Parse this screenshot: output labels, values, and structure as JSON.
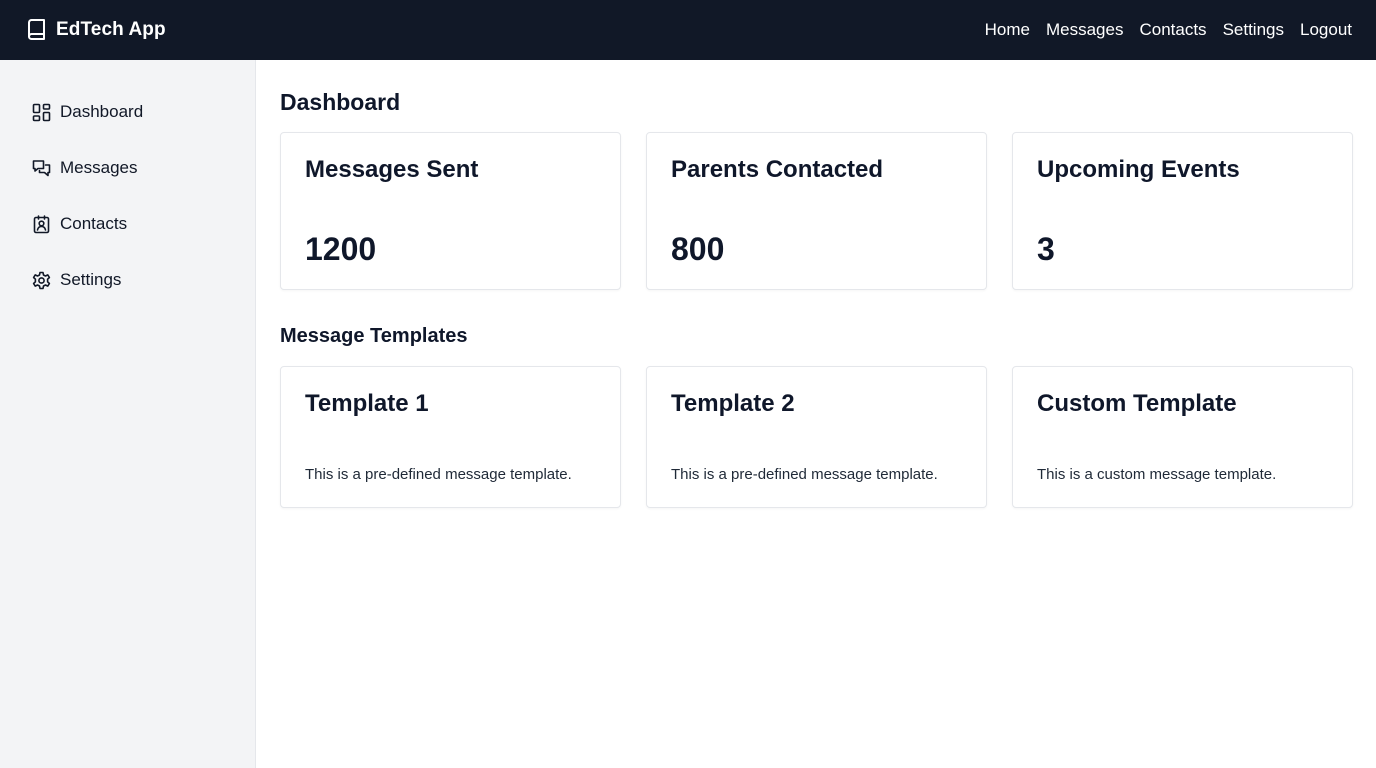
{
  "header": {
    "app_name": "EdTech App",
    "brand_icon": "book-icon",
    "background": "#111827",
    "nav": [
      {
        "label": "Home"
      },
      {
        "label": "Messages"
      },
      {
        "label": "Contacts"
      },
      {
        "label": "Settings"
      },
      {
        "label": "Logout"
      }
    ]
  },
  "sidebar": {
    "background": "#f3f4f6",
    "items": [
      {
        "label": "Dashboard",
        "icon": "dashboard-icon"
      },
      {
        "label": "Messages",
        "icon": "chat-icon"
      },
      {
        "label": "Contacts",
        "icon": "contact-card-icon"
      },
      {
        "label": "Settings",
        "icon": "gear-icon"
      }
    ]
  },
  "main": {
    "title": "Dashboard",
    "stats": [
      {
        "title": "Messages Sent",
        "value": "1200"
      },
      {
        "title": "Parents Contacted",
        "value": "800"
      },
      {
        "title": "Upcoming Events",
        "value": "3"
      }
    ],
    "templates_title": "Message Templates",
    "templates": [
      {
        "title": "Template 1",
        "description": "This is a pre-defined message template."
      },
      {
        "title": "Template 2",
        "description": "This is a pre-defined message template."
      },
      {
        "title": "Custom Template",
        "description": "This is a custom message template."
      }
    ]
  }
}
